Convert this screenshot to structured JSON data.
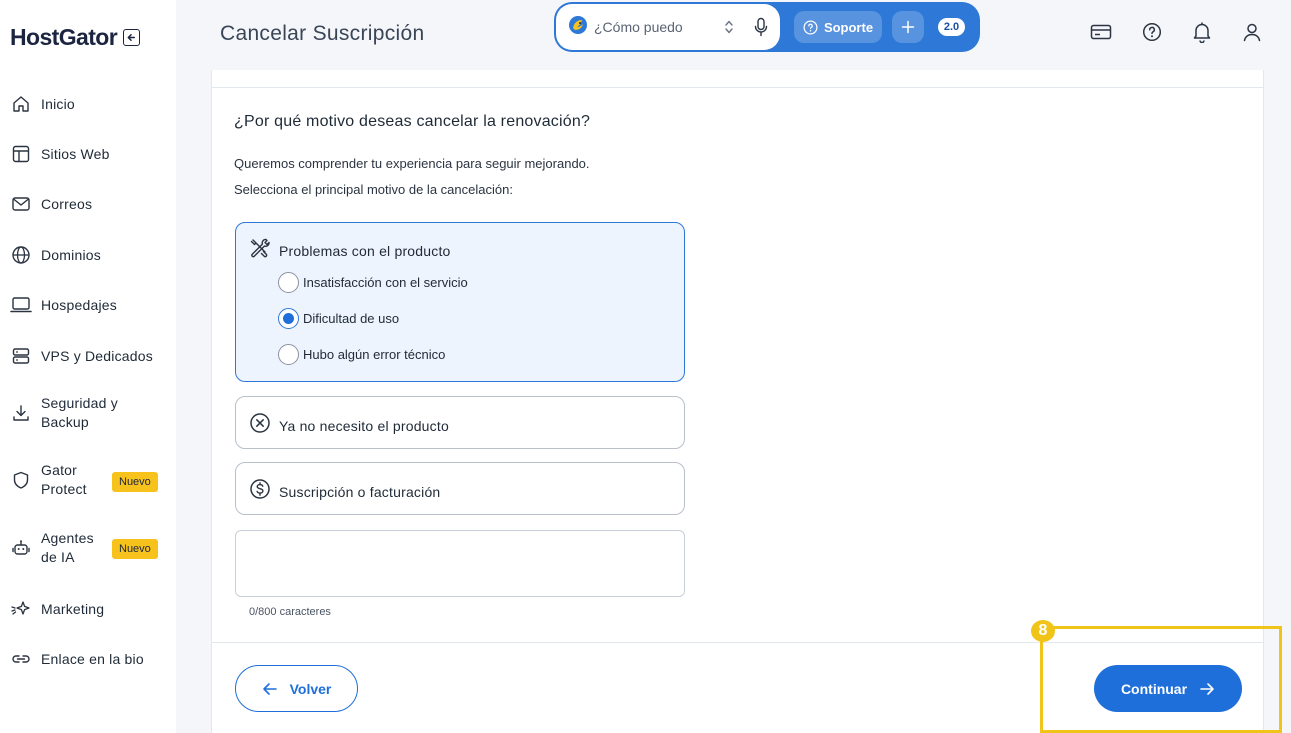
{
  "app": {
    "logo": "HostGator",
    "page_title": "Cancelar Suscripción"
  },
  "sidebar": {
    "items": [
      {
        "label": "Inicio",
        "icon": "home-icon"
      },
      {
        "label": "Sitios Web",
        "icon": "layout-icon"
      },
      {
        "label": "Correos",
        "icon": "mail-icon"
      },
      {
        "label": "Dominios",
        "icon": "globe-icon"
      },
      {
        "label": "Hospedajes",
        "icon": "laptop-icon"
      },
      {
        "label": "VPS y Dedicados",
        "icon": "server-icon"
      },
      {
        "label_line1": "Seguridad y",
        "label_line2": "Backup",
        "icon": "download-icon"
      },
      {
        "label_line1": "Gator",
        "label_line2": "Protect",
        "icon": "shield-icon",
        "badge": "Nuevo"
      },
      {
        "label_line1": "Agentes",
        "label_line2": "de IA",
        "icon": "robot-icon",
        "badge": "Nuevo"
      },
      {
        "label": "Marketing",
        "icon": "sparkle-icon"
      },
      {
        "label": "Enlace en la bio",
        "icon": "link-icon"
      }
    ]
  },
  "assistant": {
    "placeholder": "¿Cómo puedo",
    "support_label": "Soporte",
    "version": "2.0"
  },
  "form": {
    "question": "¿Por qué motivo deseas cancelar la renovación?",
    "desc1": "Queremos comprender tu experiencia para seguir mejorando.",
    "desc2": "Selecciona el principal motivo de la cancelación:",
    "groups": [
      {
        "label": "Problemas con el producto",
        "icon": "tools-icon",
        "options": [
          {
            "label": "Insatisfacción con el servicio",
            "checked": false
          },
          {
            "label": "Dificultad de uso",
            "checked": true
          },
          {
            "label": "Hubo algún error técnico",
            "checked": false
          }
        ]
      },
      {
        "label": "Ya no necesito el producto",
        "icon": "x-circle-icon"
      },
      {
        "label": "Suscripción o facturación",
        "icon": "dollar-circle-icon"
      }
    ],
    "textarea_value": "",
    "counter": "0/800 caracteres"
  },
  "actions": {
    "back": "Volver",
    "next": "Continuar"
  },
  "annotation": {
    "step": "8"
  },
  "colors": {
    "accent": "#1e6fd9",
    "highlight": "#f0c419",
    "badge": "#f6c21b"
  }
}
